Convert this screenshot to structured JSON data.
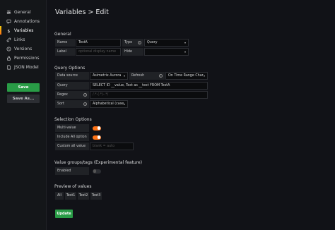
{
  "sidebar": {
    "items": [
      {
        "label": "General",
        "icon": "sliders-icon"
      },
      {
        "label": "Annotations",
        "icon": "comment-icon"
      },
      {
        "label": "Variables",
        "icon": "dollar-icon"
      },
      {
        "label": "Links",
        "icon": "link-icon"
      },
      {
        "label": "Versions",
        "icon": "history-icon"
      },
      {
        "label": "Permissions",
        "icon": "lock-icon"
      },
      {
        "label": "JSON Model",
        "icon": "file-icon"
      }
    ],
    "save_label": "Save",
    "save_as_label": "Save As..."
  },
  "header": {
    "title": "Variables > Edit"
  },
  "general": {
    "heading": "General",
    "name_label": "Name",
    "name_value": "TestA",
    "type_label": "Type",
    "type_value": "Query",
    "label_label": "Label",
    "label_placeholder": "optional display name",
    "hide_label": "Hide",
    "hide_value": ""
  },
  "query_options": {
    "heading": "Query Options",
    "datasource_label": "Data source",
    "datasource_value": "Asimetrix Aurora",
    "refresh_label": "Refresh",
    "refresh_value": "On Time Range Char",
    "query_label": "Query",
    "query_value": "SELECT ID __value, Text as __text FROM TestA",
    "regex_label": "Regex",
    "regex_placeholder": "/.*-(.*)-.*/",
    "sort_label": "Sort",
    "sort_value": "Alphabetical (case"
  },
  "selection_options": {
    "heading": "Selection Options",
    "multi_label": "Multi-value",
    "multi_enabled": true,
    "all_label": "Include All option",
    "all_enabled": true,
    "custom_label": "Custom all value",
    "custom_placeholder": "blank = auto"
  },
  "value_groups": {
    "heading": "Value groups/tags (Experimental feature)",
    "enabled_label": "Enabled",
    "enabled": false
  },
  "preview": {
    "heading": "Preview of values",
    "values": [
      "All",
      "Test1",
      "Test2",
      "Test3"
    ]
  },
  "update_label": "Update",
  "colors": {
    "accent_orange": "#ff7316",
    "save_green": "#299c46",
    "background": "#111217",
    "sidebar": "#141619"
  }
}
